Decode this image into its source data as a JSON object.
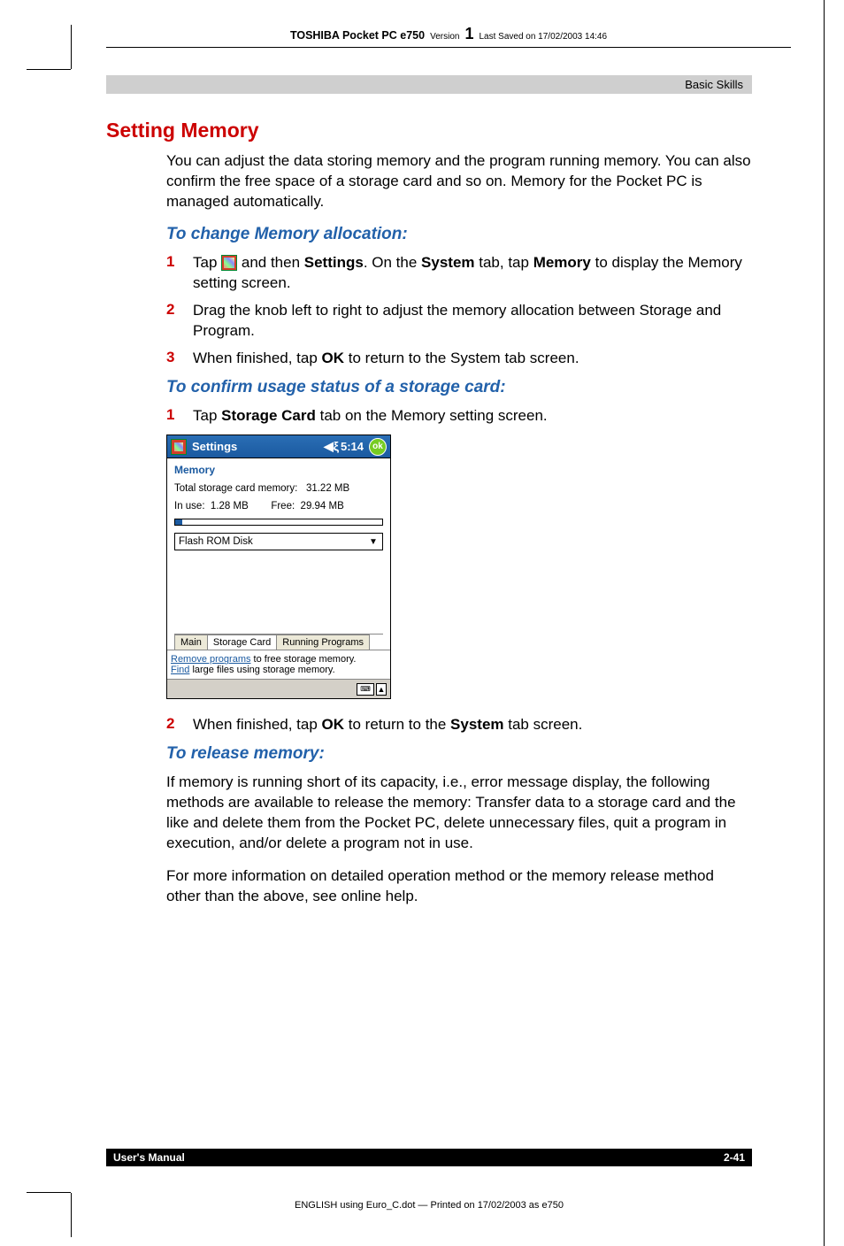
{
  "running_header": {
    "title": "TOSHIBA Pocket PC e750",
    "version_label": "Version",
    "version_number": "1",
    "saved": "Last Saved on 17/02/2003 14:46"
  },
  "section_name": "Basic Skills",
  "h1": "Setting Memory",
  "intro": "You can adjust the data storing memory and the program running memory. You can also confirm the free space of a storage card and so on. Memory for the Pocket PC is managed automatically.",
  "h2_a": "To change Memory allocation:",
  "steps_a": [
    {
      "num": "1",
      "pre": "Tap ",
      "post_icon": " and then ",
      "b1": "Settings",
      "mid": ". On the ",
      "b2": "System",
      "mid2": " tab, tap ",
      "b3": "Memory",
      "tail": " to display the Memory setting screen."
    },
    {
      "num": "2",
      "text": "Drag the knob left to right to adjust the memory allocation between Storage and Program."
    },
    {
      "num": "3",
      "pre": "When finished, tap ",
      "b1": "OK",
      "tail": " to return to the System tab screen."
    }
  ],
  "h2_b": "To confirm usage status of a storage card:",
  "steps_b": [
    {
      "num": "1",
      "pre": "Tap ",
      "b1": "Storage Card",
      "tail": " tab on the Memory setting screen."
    }
  ],
  "ppc": {
    "title": "Settings",
    "time": "5:14",
    "ok": "ok",
    "heading": "Memory",
    "total_label": "Total storage card memory:",
    "total_value": "31.22 MB",
    "inuse_label": "In use:",
    "inuse_value": "1.28 MB",
    "free_label": "Free:",
    "free_value": "29.94 MB",
    "select_value": "Flash ROM Disk",
    "tabs": [
      "Main",
      "Storage Card",
      "Running Programs"
    ],
    "link1_a": "Remove programs",
    "link1_b": " to free storage memory.",
    "link2_a": "Find",
    "link2_b": " large files using storage memory."
  },
  "steps_c": [
    {
      "num": "2",
      "pre": "When finished, tap ",
      "b1": "OK",
      "mid": " to return to the ",
      "b2": "System",
      "tail": " tab screen."
    }
  ],
  "h2_c": "To release memory:",
  "release_p1": "If memory is running short of its capacity, i.e., error message display, the following methods are available to release the memory: Transfer data to a storage card and the like and delete them from the Pocket PC, delete unnecessary files, quit a program in execution, and/or delete a program not in use.",
  "release_p2": "For more information on detailed operation method or the memory release method other than the above, see online help.",
  "footer": {
    "left": "User's Manual",
    "right": "2-41"
  },
  "print_note": "ENGLISH using Euro_C.dot — Printed on 17/02/2003 as e750"
}
